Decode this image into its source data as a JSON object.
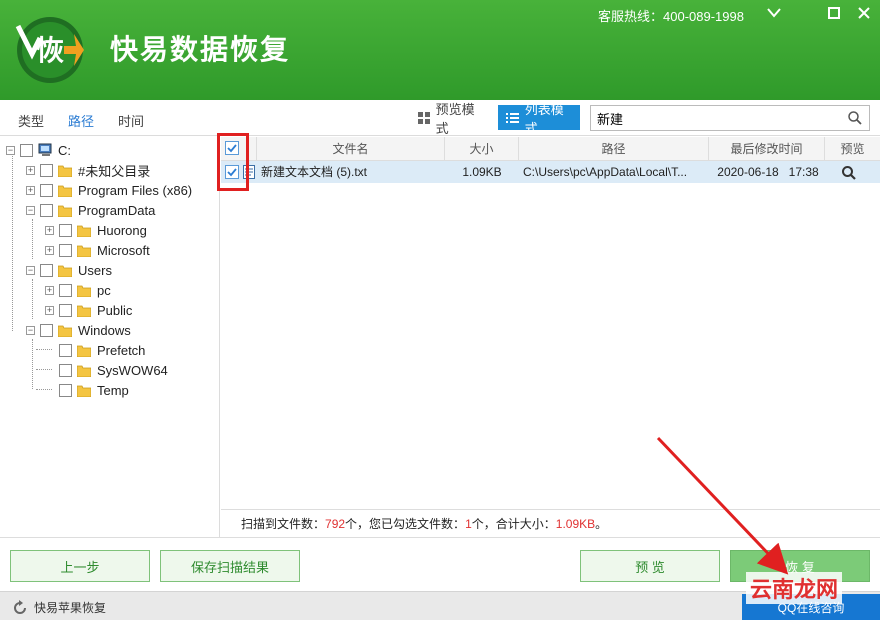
{
  "app": {
    "title": "快易数据恢复",
    "logo_char": "恢",
    "hotline": "客服热线：400-089-1998"
  },
  "tabs": [
    {
      "label": "类型",
      "active": false
    },
    {
      "label": "路径",
      "active": true
    },
    {
      "label": "时间",
      "active": false
    }
  ],
  "view_modes": {
    "preview_label": "预览模式",
    "list_label": "列表模式",
    "active": "list"
  },
  "search": {
    "value": "新建",
    "placeholder": ""
  },
  "tree": {
    "root": "C:",
    "items": [
      {
        "label": "#未知父目录"
      },
      {
        "label": "Program Files (x86)"
      },
      {
        "label": "ProgramData"
      },
      {
        "label": "Huorong"
      },
      {
        "label": "Microsoft"
      },
      {
        "label": "Users"
      },
      {
        "label": "pc"
      },
      {
        "label": "Public"
      },
      {
        "label": "Windows"
      },
      {
        "label": "Prefetch"
      },
      {
        "label": "SysWOW64"
      },
      {
        "label": "Temp"
      }
    ]
  },
  "file_list": {
    "columns": [
      "文件名",
      "大小",
      "路径",
      "最后修改时间",
      "预览"
    ],
    "rows": [
      {
        "name": "新建文本文档 (5).txt",
        "size": "1.09KB",
        "path": "C:\\Users\\pc\\AppData\\Local\\T...",
        "modified": "2020-06-18   17:38",
        "checked": true
      }
    ]
  },
  "status": {
    "prefix": "扫描到文件数：",
    "scanned": "792",
    "mid1": "个，您已勾选文件数：",
    "selected": "1",
    "mid2": "个，合计大小：",
    "total": "1.09KB",
    "suffix": "。"
  },
  "buttons": {
    "back": "上一步",
    "save_scan": "保存扫描结果",
    "preview": "预 览",
    "recover": "恢 复"
  },
  "footer": {
    "apple_recover": "快易苹果恢复",
    "qq_consult": "QQ在线咨询"
  },
  "watermark": "云南龙网",
  "colors": {
    "header_green": "#3aa632",
    "accent_blue": "#1d8ed8",
    "highlight_red": "#e03131"
  }
}
